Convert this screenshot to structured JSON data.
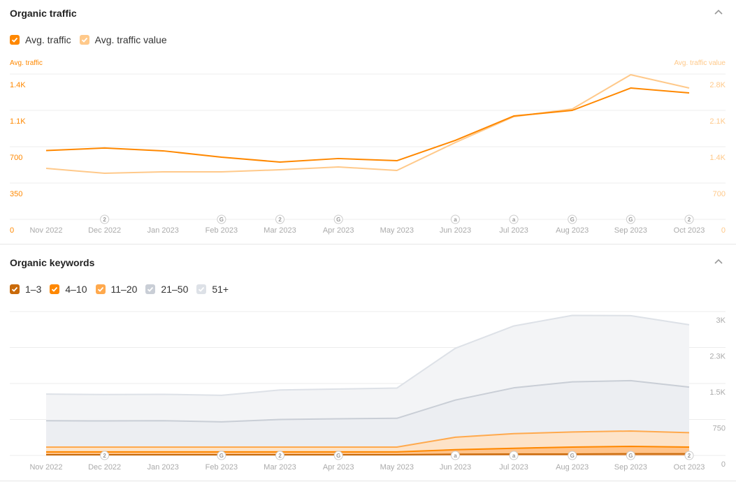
{
  "traffic_section": {
    "title": "Organic traffic",
    "legend": [
      {
        "label": "Avg. traffic",
        "color": "#ff8800",
        "checked": true
      },
      {
        "label": "Avg. traffic value",
        "color": "#ffc98a",
        "checked": true
      }
    ],
    "left_axis_title": "Avg. traffic",
    "right_axis_title": "Avg. traffic value"
  },
  "keywords_section": {
    "title": "Organic keywords",
    "legend": [
      {
        "label": "1–3",
        "color": "#c96a0a",
        "checked": true
      },
      {
        "label": "4–10",
        "color": "#ff8800",
        "checked": true
      },
      {
        "label": "11–20",
        "color": "#ffa94d",
        "checked": true
      },
      {
        "label": "21–50",
        "color": "#c9ced6",
        "checked": true
      },
      {
        "label": "51+",
        "color": "#dde1e7",
        "checked": true
      }
    ]
  },
  "annotations": [
    {
      "month": "Dec 2022",
      "glyph": "2"
    },
    {
      "month": "Feb 2023",
      "glyph": "G"
    },
    {
      "month": "Mar 2023",
      "glyph": "2"
    },
    {
      "month": "Apr 2023",
      "glyph": "G"
    },
    {
      "month": "Jun 2023",
      "glyph": "a"
    },
    {
      "month": "Jul 2023",
      "glyph": "a"
    },
    {
      "month": "Aug 2023",
      "glyph": "G"
    },
    {
      "month": "Sep 2023",
      "glyph": "G"
    },
    {
      "month": "Oct 2023",
      "glyph": "2"
    }
  ],
  "chart_data": [
    {
      "type": "line",
      "title": "Organic traffic",
      "categories": [
        "Nov 2022",
        "Dec 2022",
        "Jan 2023",
        "Feb 2023",
        "Mar 2023",
        "Apr 2023",
        "May 2023",
        "Jun 2023",
        "Jul 2023",
        "Aug 2023",
        "Sep 2023",
        "Oct 2023"
      ],
      "series": [
        {
          "name": "Avg. traffic",
          "axis": "left",
          "color": "#ff8800",
          "values": [
            663,
            687,
            660,
            599,
            552,
            586,
            565,
            761,
            996,
            1050,
            1265,
            1218
          ]
        },
        {
          "name": "Avg. traffic value",
          "axis": "right",
          "color": "#ffc98a",
          "values": [
            983,
            888,
            915,
            915,
            956,
            1010,
            942,
            1481,
            1979,
            2127,
            2787,
            2531
          ]
        }
      ],
      "left_axis": {
        "title": "Avg. traffic",
        "ticks": [
          "0",
          "350",
          "700",
          "1.1K",
          "1.4K"
        ],
        "ylim": [
          0,
          1750
        ],
        "color": "#ff8800"
      },
      "right_axis": {
        "title": "Avg. traffic value",
        "ticks": [
          "0",
          "700",
          "1.4K",
          "2.1K",
          "2.8K"
        ],
        "ylim": [
          0,
          3500
        ],
        "color": "#ffc98a"
      },
      "grid": true,
      "legend": "top-left"
    },
    {
      "type": "area",
      "stacked": true,
      "title": "Organic keywords",
      "categories": [
        "Nov 2022",
        "Dec 2022",
        "Jan 2023",
        "Feb 2023",
        "Mar 2023",
        "Apr 2023",
        "May 2023",
        "Jun 2023",
        "Jul 2023",
        "Aug 2023",
        "Sep 2023",
        "Oct 2023"
      ],
      "series": [
        {
          "name": "1–3",
          "color": "#c96a0a",
          "values": [
            15,
            15,
            15,
            15,
            15,
            15,
            15,
            25,
            30,
            30,
            35,
            35
          ]
        },
        {
          "name": "4–10",
          "color": "#ff8800",
          "values": [
            60,
            60,
            60,
            60,
            60,
            60,
            60,
            95,
            120,
            145,
            155,
            140
          ]
        },
        {
          "name": "11–20",
          "color": "#ffa94d",
          "values": [
            100,
            100,
            100,
            100,
            100,
            100,
            100,
            260,
            305,
            315,
            320,
            300
          ]
        },
        {
          "name": "21–50",
          "color": "#c9ced6",
          "values": [
            550,
            545,
            550,
            525,
            575,
            590,
            600,
            775,
            955,
            1045,
            1050,
            950
          ]
        },
        {
          "name": "51+",
          "color": "#dde1e7",
          "values": [
            555,
            550,
            550,
            555,
            615,
            620,
            630,
            1080,
            1290,
            1385,
            1355,
            1300
          ]
        }
      ],
      "right_axis": {
        "ticks": [
          "0",
          "750",
          "1.5K",
          "2.3K",
          "3K"
        ],
        "ylim": [
          0,
          3750
        ]
      },
      "grid": true,
      "legend": "top-left"
    }
  ]
}
